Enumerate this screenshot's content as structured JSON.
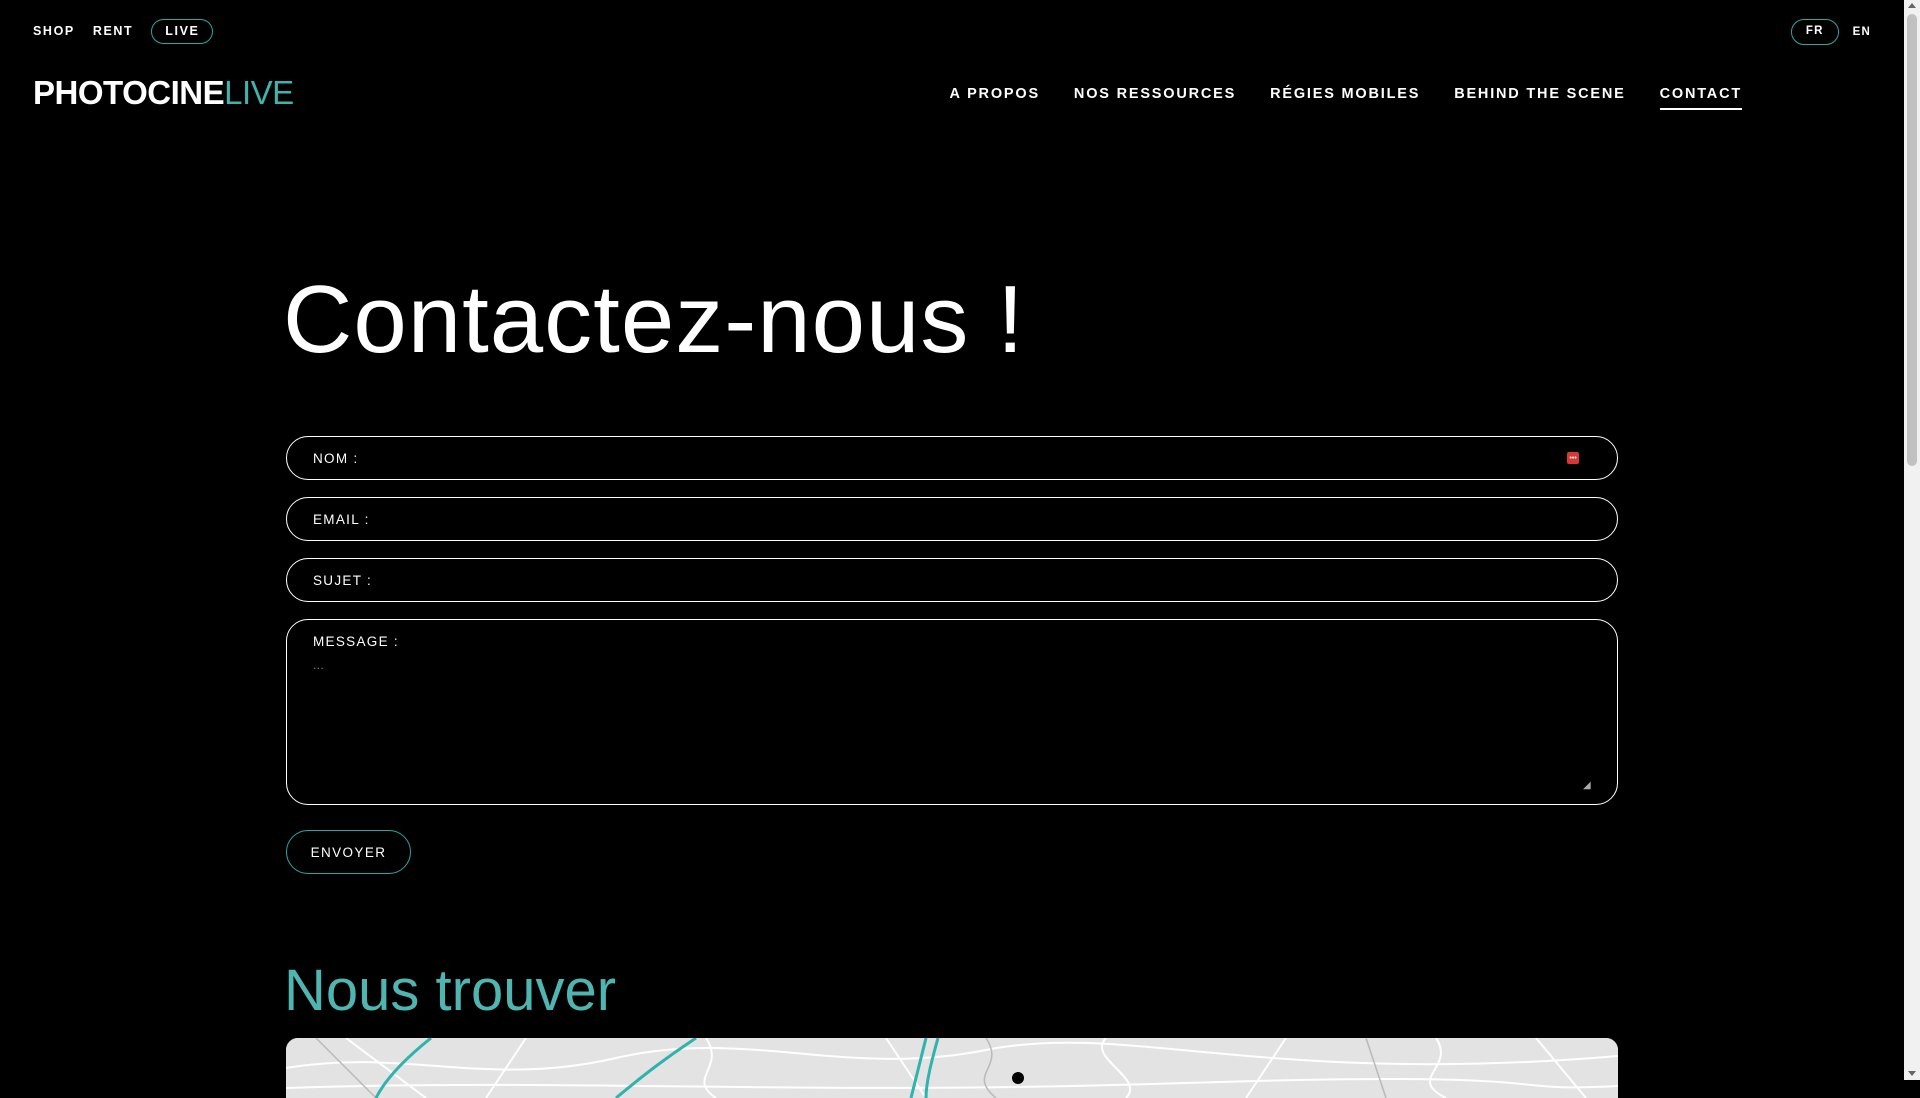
{
  "topbar": {
    "links": [
      {
        "label": "SHOP"
      },
      {
        "label": "RENT"
      },
      {
        "label": "LIVE"
      }
    ],
    "languages": [
      {
        "label": "FR"
      },
      {
        "label": "EN"
      }
    ]
  },
  "logo": {
    "part1": "PHOTOCINE",
    "part2": "LIVE"
  },
  "nav": {
    "items": [
      {
        "label": "A PROPOS"
      },
      {
        "label": "NOS RESSOURCES"
      },
      {
        "label": "RÉGIES MOBILES"
      },
      {
        "label": "BEHIND THE SCENE"
      },
      {
        "label": "CONTACT"
      }
    ],
    "active": "CONTACT"
  },
  "title": "Contactez-nous !",
  "form": {
    "name_label": "NOM :",
    "email_label": "EMAIL :",
    "subject_label": "SUJET :",
    "message_label": "MESSAGE :",
    "message_placeholder": "...",
    "submit_label": "ENVOYER"
  },
  "map_section": {
    "title": "Nous trouver"
  },
  "colors": {
    "background": "#000000",
    "accent": "#2fa6a0",
    "subtitle": "#4fb5b0",
    "text": "#ffffff"
  }
}
